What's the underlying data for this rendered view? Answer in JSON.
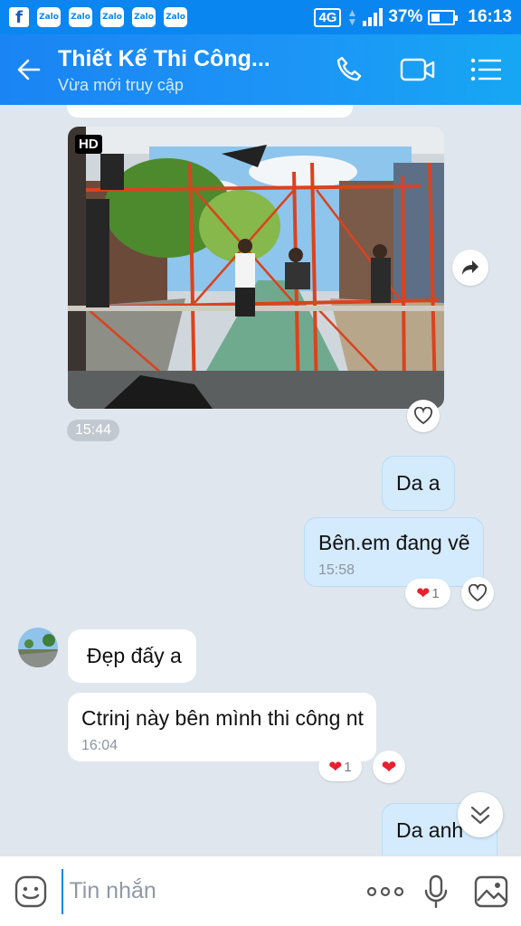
{
  "status_bar": {
    "notification_icons": [
      "facebook-icon",
      "zalo-icon",
      "zalo-icon",
      "zalo-icon",
      "zalo-icon",
      "zalo-icon"
    ],
    "zalo_label": "Zalo",
    "facebook_label": "f",
    "network": "4G",
    "battery": "37%",
    "time": "16:13"
  },
  "header": {
    "title": "Thiết Kế Thi Công...",
    "subtitle": "Vừa mới truy cập",
    "colors": {
      "gradient_start": "#1a84f4",
      "gradient_end": "#16a7f4"
    }
  },
  "messages": {
    "photo": {
      "badge": "HD",
      "time": "15:44"
    },
    "me_1": {
      "text": "Da a"
    },
    "me_2": {
      "text": "Bên.em đang vẽ",
      "time": "15:58",
      "reaction_count": "1"
    },
    "them_1": {
      "text": "Đẹp đấy a"
    },
    "them_2": {
      "text": "Ctrinj này bên mình thi công nt",
      "time": "16:04",
      "reaction_count": "1"
    },
    "me_3": {
      "text": "Da anh"
    }
  },
  "composer": {
    "placeholder": "Tin nhắn"
  },
  "colors": {
    "accent": "#0a86f0",
    "my_bubble": "#d4eafd",
    "their_bubble": "#ffffff",
    "chat_background": "#dfe6ee",
    "heart": "#e8202f"
  }
}
